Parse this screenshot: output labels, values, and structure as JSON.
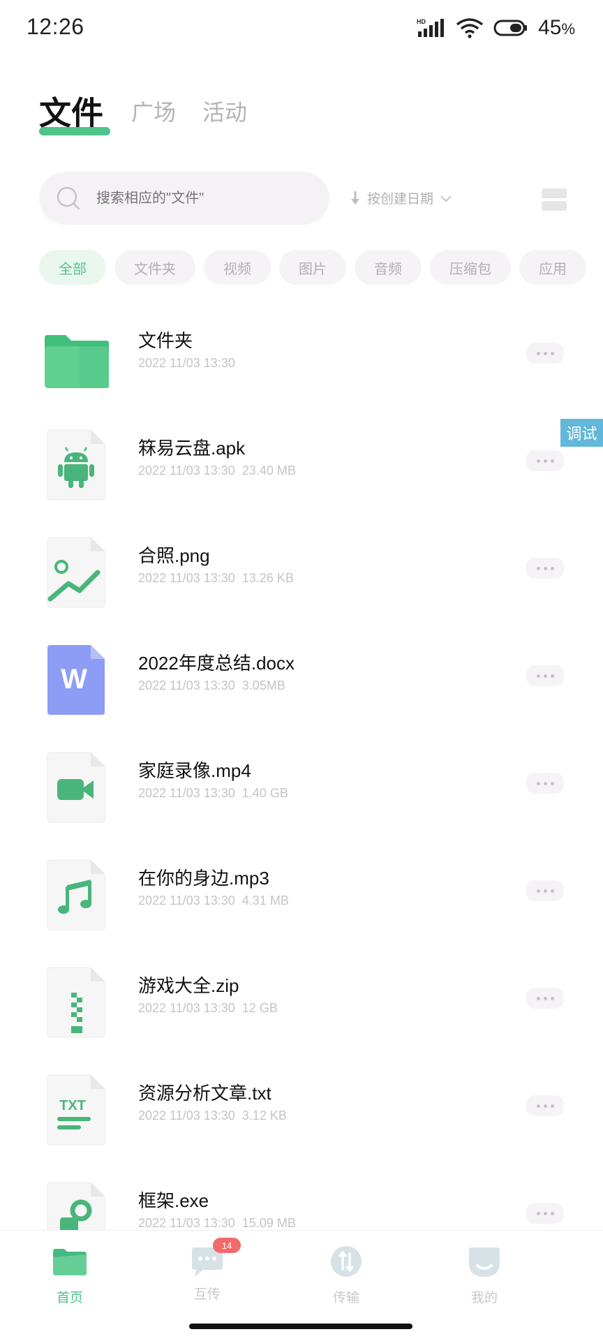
{
  "status_bar": {
    "time": "12:26",
    "battery_value": "45",
    "battery_unit": "%",
    "network_label": "HD"
  },
  "tabs": [
    {
      "label": "文件"
    },
    {
      "label": "广场"
    },
    {
      "label": "活动"
    }
  ],
  "search": {
    "placeholder": "搜索相应的\"文件\"",
    "search_icon": "search-icon"
  },
  "sort": {
    "label": "按创建日期"
  },
  "chips": [
    {
      "label": "全部"
    },
    {
      "label": "文件夹"
    },
    {
      "label": "视频"
    },
    {
      "label": "图片"
    },
    {
      "label": "音频"
    },
    {
      "label": "压缩包"
    },
    {
      "label": "应用"
    }
  ],
  "files": [
    {
      "name": "文件夹",
      "date": "2022 11/03 13:30",
      "size": "",
      "icon": "folder-icon"
    },
    {
      "name": "箖易云盘.apk",
      "date": "2022 11/03 13:30",
      "size": "23.40 MB",
      "icon": "android-icon"
    },
    {
      "name": "合照.png",
      "date": "2022 11/03 13:30",
      "size": "13.26 KB",
      "icon": "image-icon"
    },
    {
      "name": "2022年度总结.docx",
      "date": "2022 11/03 13:30",
      "size": "3.05MB",
      "icon": "word-icon"
    },
    {
      "name": "家庭录像.mp4",
      "date": "2022 11/03 13:30",
      "size": "1.40 GB",
      "icon": "video-icon"
    },
    {
      "name": "在你的身边.mp3",
      "date": "2022 11/03 13:30",
      "size": "4.31 MB",
      "icon": "music-icon"
    },
    {
      "name": "游戏大全.zip",
      "date": "2022 11/03 13:30",
      "size": "12 GB",
      "icon": "zip-icon"
    },
    {
      "name": "资源分析文章.txt",
      "date": "2022 11/03 13:30",
      "size": "3.12 KB",
      "icon": "txt-icon"
    },
    {
      "name": "框架.exe",
      "date": "2022 11/03 13:30",
      "size": "15.09 MB",
      "icon": "exe-icon"
    }
  ],
  "txt_icon_text": "TXT",
  "word_icon_text": "W",
  "debug_label": "调试",
  "bottom_nav": [
    {
      "label": "首页",
      "icon": "folder-icon"
    },
    {
      "label": "互传",
      "icon": "chat-icon",
      "badge": "14"
    },
    {
      "label": "传输",
      "icon": "transfer-icon"
    },
    {
      "label": "我的",
      "icon": "profile-icon"
    }
  ],
  "colors": {
    "accent": "#4fc38a",
    "badge": "#f26a6a",
    "word": "#8d9cf5",
    "debug": "#62b7da"
  }
}
